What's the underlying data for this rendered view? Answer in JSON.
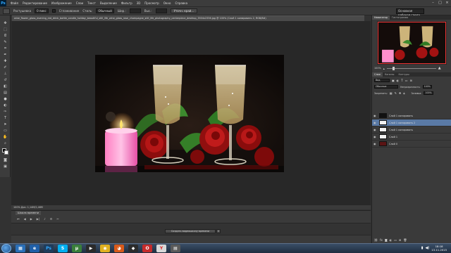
{
  "menubar": {
    "logo": "Ps",
    "items": [
      "Файл",
      "Редактирование",
      "Изображение",
      "Слои",
      "Текст",
      "Выделение",
      "Фильтр",
      "3D",
      "Просмотр",
      "Окно",
      "Справка"
    ]
  },
  "options": {
    "tool_size": "Стиль",
    "label1": "Растушевка",
    "field1": "0 пикс",
    "check_label": "Сглаживание",
    "label2": "Стиль:",
    "field2": "Обычный",
    "label3": "Шир.:",
    "label4": "Выс.:",
    "refine_btn": "Уточн. край...",
    "workspace": "Основная рабочая среда"
  },
  "document_tab": {
    "title": "wine_flower_glass_evening_red_drink_bottle_candle_holiday_beautiful_still_life_wine_glass_rose_champagne_still_life_photography_centerpiece_desktop_3504x2336.jpg @ 100% (Слой 1 копировать 2, RGB/8#)"
  },
  "status": {
    "text": "100%   Док: 1,14M/2,46M"
  },
  "timeline": {
    "tab": "Шкала времени",
    "create_button": "Создать видеошкалу времени"
  },
  "panels": {
    "top_tabs": [
      "Навигатор",
      "Гистограмма"
    ],
    "zoom": "100%",
    "layer_tabs": [
      "Слои",
      "Каналы",
      "Контуры"
    ],
    "kind_label": "Вид",
    "blend_mode": "Обычные",
    "opacity_label": "Непрозрачность:",
    "opacity": "100%",
    "lock_label": "Закрепить:",
    "fill_label": "Заливка:",
    "fill": "100%",
    "layers": [
      {
        "name": "Слой 1 копировать",
        "selected": false,
        "thumb": "dark"
      },
      {
        "name": "Слой 1 копировать 2",
        "selected": true,
        "thumb": "white"
      },
      {
        "name": "Слой 1 копировать",
        "selected": false,
        "thumb": "white"
      },
      {
        "name": "Слой 1",
        "selected": false,
        "thumb": "white"
      },
      {
        "name": "Слой 0",
        "selected": false,
        "thumb": "photo"
      }
    ]
  },
  "taskbar": {
    "time": "18:18",
    "date": "13.11.2015"
  },
  "colors": {
    "accent": "#5a7aa6",
    "app_bg": "#323232",
    "canvas_bg": "#282828"
  }
}
